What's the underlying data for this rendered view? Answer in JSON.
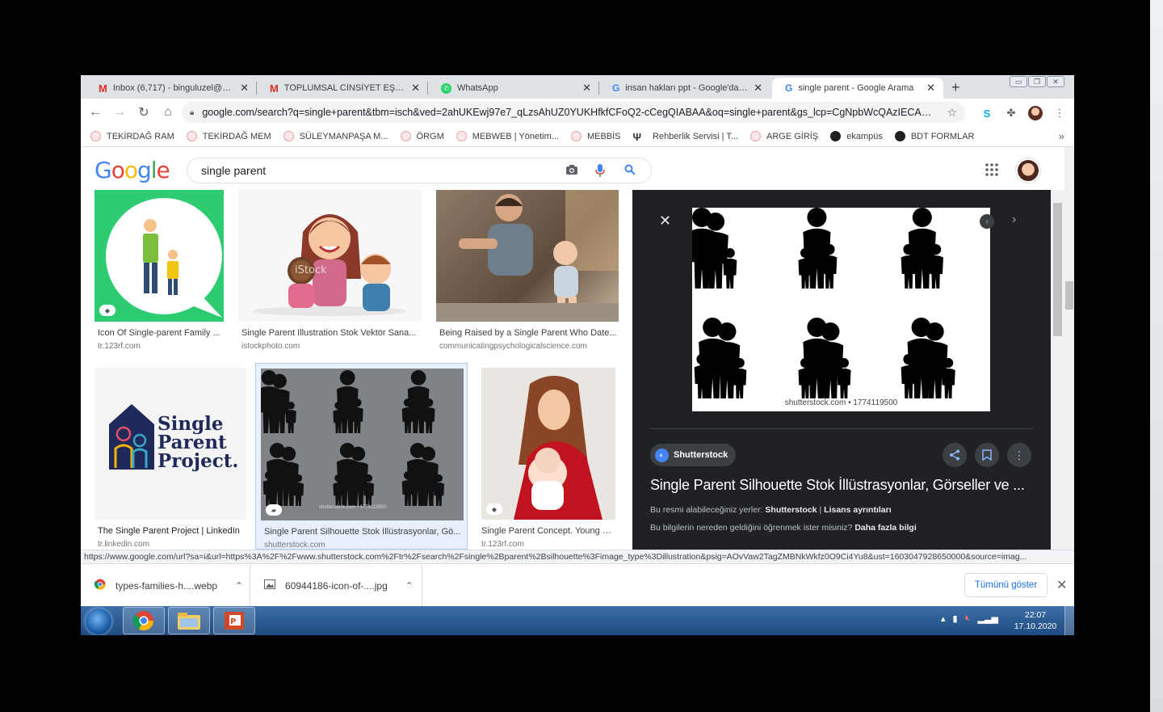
{
  "tabs": [
    {
      "label": "Inbox (6,717) - binguluzel@gmail.com",
      "icon": "gmail-icon"
    },
    {
      "label": "TOPLUMSAL CİNSİYET EŞİTLİĞİ",
      "icon": "gmail-icon"
    },
    {
      "label": "WhatsApp",
      "icon": "whatsapp-icon"
    },
    {
      "label": "insan hakları ppt - Google'da Ara",
      "icon": "google-icon"
    },
    {
      "label": "single parent - Google Arama",
      "icon": "google-icon"
    }
  ],
  "address": {
    "url": "google.com/search?q=single+parent&tbm=isch&ved=2ahUKEwj97e7_qLzsAhUZ0YUKHfkfCFoQ2-cCegQIABAA&oq=single+parent&gs_lcp=CgNpbWcQAzIECAA..."
  },
  "bookmarks": [
    {
      "label": "TEKİRDAĞ RAM"
    },
    {
      "label": "TEKİRDAĞ MEM"
    },
    {
      "label": "SÜLEYMANPAŞA M..."
    },
    {
      "label": "ÖRGM"
    },
    {
      "label": "MEBWEB | Yönetim..."
    },
    {
      "label": "MEBBİS"
    },
    {
      "label": "Rehberlik Servisi | T..."
    },
    {
      "label": "ARGE GİRİŞ"
    },
    {
      "label": "ekampüs"
    },
    {
      "label": "BDT FORMLAR"
    }
  ],
  "search": {
    "query": "single parent"
  },
  "results": [
    {
      "caption": "Icon Of Single-parent Family ...",
      "source": "tr.123rf.com"
    },
    {
      "caption": "Single Parent Illustration Stok Vektör Sana...",
      "source": "istockphoto.com"
    },
    {
      "caption": "Being Raised by a Single Parent Who Date...",
      "source": "communicatingpsychologicalscience.com"
    },
    {
      "caption": "The Single Parent Project | LinkedIn",
      "source": "tr.linkedin.com"
    },
    {
      "caption": "Single Parent Silhouette Stok İllüstrasyonlar, Gö...",
      "source": "shutterstock.com"
    },
    {
      "caption": "Single Parent Concept. Young E...",
      "source": "tr.123rf.com"
    }
  ],
  "logo_card": {
    "line1": "Single",
    "line2": "Parent",
    "line3": "Project."
  },
  "watermark_small": "shutterstock.com • 1774119500",
  "preview": {
    "image_caption": "shutterstock.com • 1774119500",
    "source_name": "Shutterstock",
    "title": "Single Parent Silhouette Stok İllüstrasyonlar, Görseller ve ...",
    "line1_prefix": "Bu resmi alabileceğiniz yerler:",
    "line1_link1": "Shutterstock",
    "line1_sep": "|",
    "line1_link2": "Lisans ayrıntıları",
    "line2_prefix": "Bu bilgilerin nereden geldiğini öğrenmek ister misiniz?",
    "line2_link": "Daha fazla bilgi"
  },
  "status_url": "https://www.google.com/url?sa=i&url=https%3A%2F%2Fwww.shutterstock.com%2Ftr%2Fsearch%2Fsingle%2Bparent%2Bsilhouette%3Fimage_type%3Dillustration&psig=AOvVaw2TagZMBNkWkfz0O9Ci4Yu8&ust=1603047928650000&source=imag...",
  "downloads": [
    {
      "name": "types-families-h....webp"
    },
    {
      "name": "60944186-icon-of-....jpg"
    }
  ],
  "download_show_all": "Tümünü göster",
  "taskbar": {
    "time": "22:07",
    "date": "17.10.2020"
  },
  "colors": {
    "accent": "#1a73e8",
    "panel_bg": "#202124",
    "tab_bar": "#dee1e6",
    "gmail_red": "#d93025",
    "green_bg": "#2ecc71",
    "navy": "#1f2a5a"
  }
}
